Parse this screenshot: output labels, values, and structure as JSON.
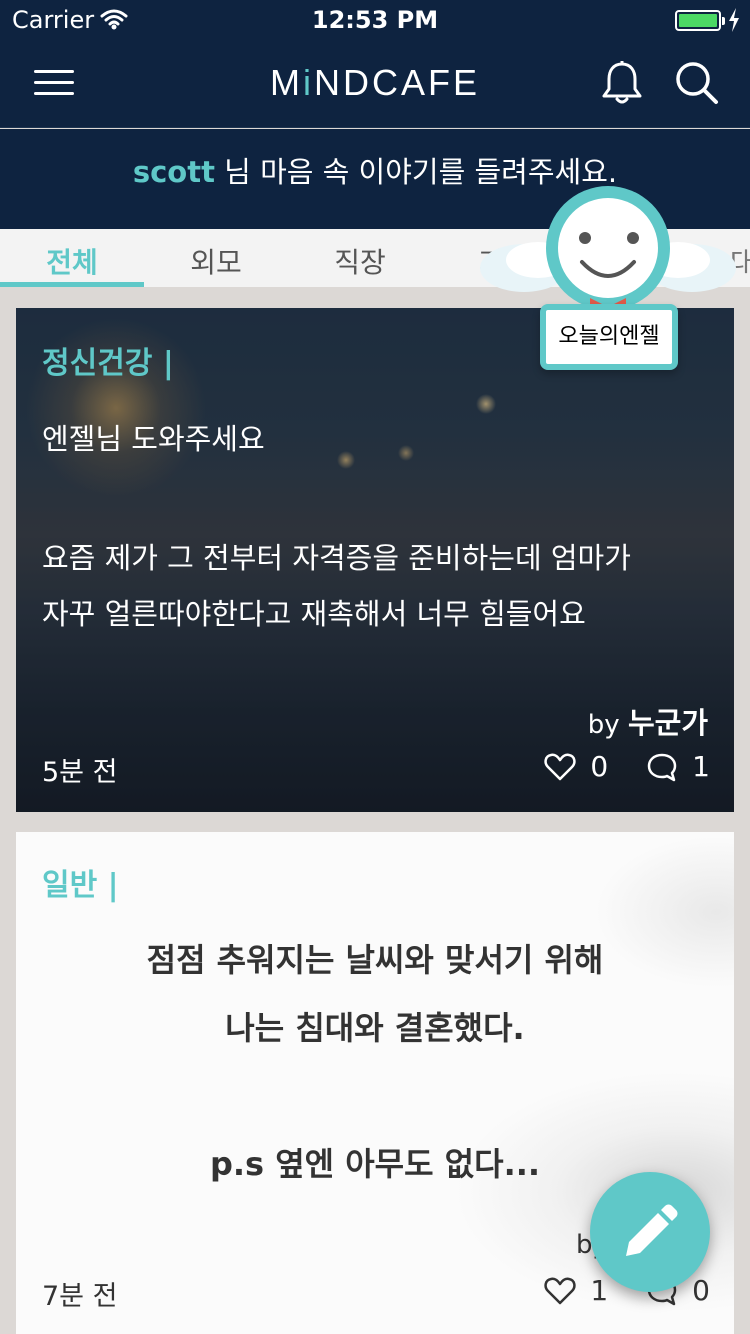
{
  "status_bar": {
    "carrier": "Carrier",
    "time": "12:53 PM",
    "battery_level": 1.0
  },
  "navbar": {
    "logo_prefix": "M",
    "logo_accent": "i",
    "logo_suffix": "NDCAFE"
  },
  "greeting": {
    "user": "scott",
    "message": " 님 마음 속 이야기를 들려주세요."
  },
  "tabs": [
    {
      "label": "전체",
      "active": true
    },
    {
      "label": "외모",
      "active": false
    },
    {
      "label": "직장",
      "active": false
    },
    {
      "label": "기타",
      "active": false
    },
    {
      "label": "대",
      "active": false
    }
  ],
  "angel_badge": {
    "label": "오늘의엔젤"
  },
  "posts": [
    {
      "category": "정신건강 |",
      "title": "엔젤님 도와주세요",
      "body_line1": "요즘 제가 그 전부터 자격증을 준비하는데 엄마가",
      "body_line2": "자꾸 얼른따야한다고 재촉해서 너무 힘들어요",
      "author_prefix": "by ",
      "author": "누군가",
      "time": "5분 전",
      "likes": "0",
      "comments": "1"
    },
    {
      "category": "일반 |",
      "body_line1": "점점 추워지는 날씨와 맞서기 위해",
      "body_line2": "나는 침대와 결혼했다.",
      "body_line3": "p.s 옆엔 아무도 없다...",
      "author_prefix": "by",
      "time": "7분 전",
      "likes": "1",
      "comments": "0"
    }
  ],
  "colors": {
    "navy": "#0e2340",
    "accent": "#5fc8c8"
  },
  "icons": [
    "menu-icon",
    "bell-icon",
    "search-icon",
    "heart-icon",
    "comment-icon",
    "pencil-icon",
    "wifi-icon",
    "bolt-icon"
  ]
}
